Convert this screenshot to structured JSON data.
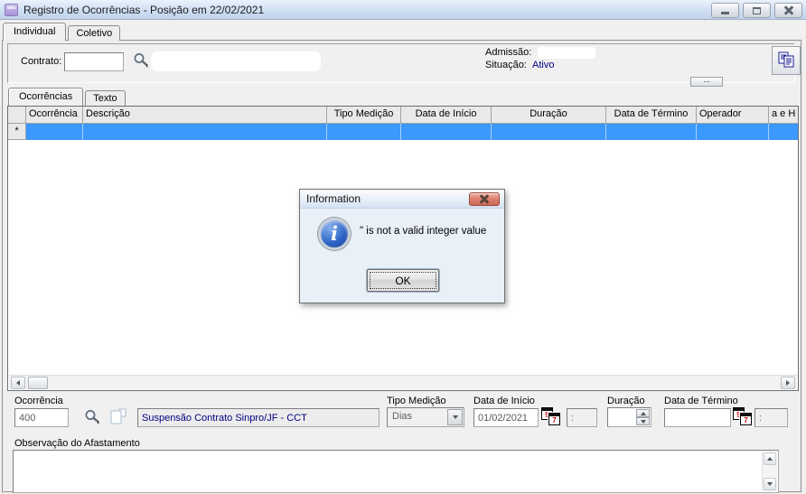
{
  "window": {
    "title": "Registro de Ocorrências - Posição em 22/02/2021"
  },
  "main_tabs": {
    "individual": "Individual",
    "coletivo": "Coletivo"
  },
  "header": {
    "contrato_label": "Contrato:",
    "contrato_value": "",
    "admissao_label": "Admissão:",
    "situacao_label": "Situação:",
    "situacao_value": "Ativo",
    "situacao_color": "#000080",
    "more_button": "..."
  },
  "inner_tabs": {
    "ocorrencias": "Ocorrências",
    "texto": "Texto"
  },
  "grid": {
    "columns": [
      "Ocorrência",
      "Descrição",
      "Tipo Medição",
      "Data de Início",
      "Duração",
      "Data de Término",
      "Operador",
      "a e H"
    ],
    "new_row_indicator": "*",
    "selected_row_color": "#3b99fd"
  },
  "dialog": {
    "title": "Information",
    "message": "\" is not a valid integer value",
    "ok_label": "OK"
  },
  "form": {
    "ocorrencia_label": "Ocorrência",
    "ocorrencia_value": "400",
    "descricao_value": "Suspensão Contrato Sinpro/JF - CCT",
    "tipo_medicao_label": "Tipo Medição",
    "tipo_medicao_value": "Dias",
    "data_inicio_label": "Data de Início",
    "data_inicio_value": "01/02/2021",
    "hora_inicio_value": ":",
    "duracao_label": "Duração",
    "duracao_value": "",
    "data_termino_label": "Data de Término",
    "data_termino_value": "",
    "hora_termino_value": ":"
  },
  "observacao": {
    "label": "Observação do Afastamento",
    "value": ""
  },
  "icons": {
    "calendar_back_digit": "9",
    "calendar_front_digit": "7"
  }
}
